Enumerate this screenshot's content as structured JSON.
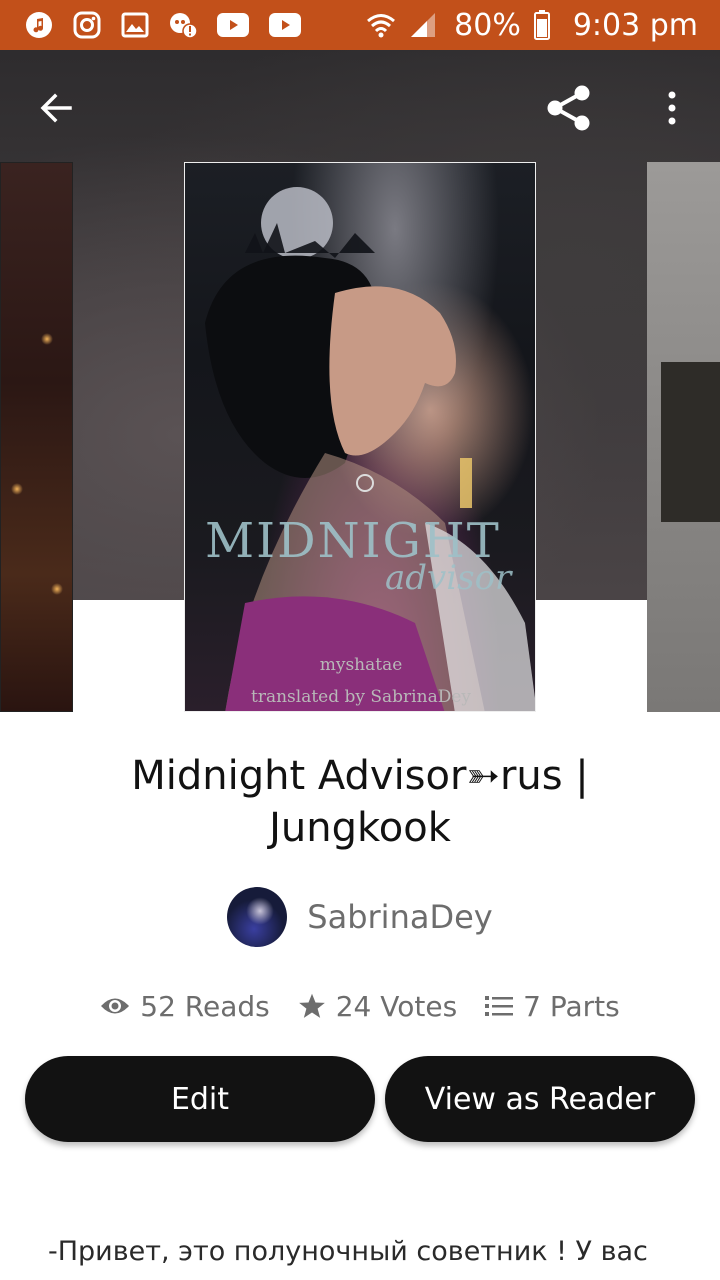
{
  "status_bar": {
    "battery": "80%",
    "time": "9:03 pm",
    "icons": [
      "music-icon",
      "instagram-icon",
      "image-icon",
      "app-alert-icon",
      "youtube-icon",
      "youtube-icon",
      "wifi-icon",
      "signal-icon",
      "battery-icon"
    ]
  },
  "toolbar": {
    "back_icon": "arrow-left-icon",
    "share_icon": "share-icon",
    "more_icon": "more-vertical-icon"
  },
  "covers": {
    "center_title": "MIDNIGHT",
    "center_subtitle": "advisor",
    "center_author": "myshatae",
    "center_translator": "translated by SabrinaDey"
  },
  "book": {
    "title": "Midnight Advisor➳rus | Jungkook",
    "author": "SabrinaDey",
    "reads": "52 Reads",
    "votes": "24 Votes",
    "parts": "7 Parts"
  },
  "actions": {
    "edit_label": "Edit",
    "reader_label": "View as Reader"
  },
  "description": {
    "first_line": "-Привет, это полуночный советник ! У вас"
  },
  "colors": {
    "status_bar": "#c2501a",
    "button": "#121212",
    "meta_text": "#6d6d6d"
  }
}
